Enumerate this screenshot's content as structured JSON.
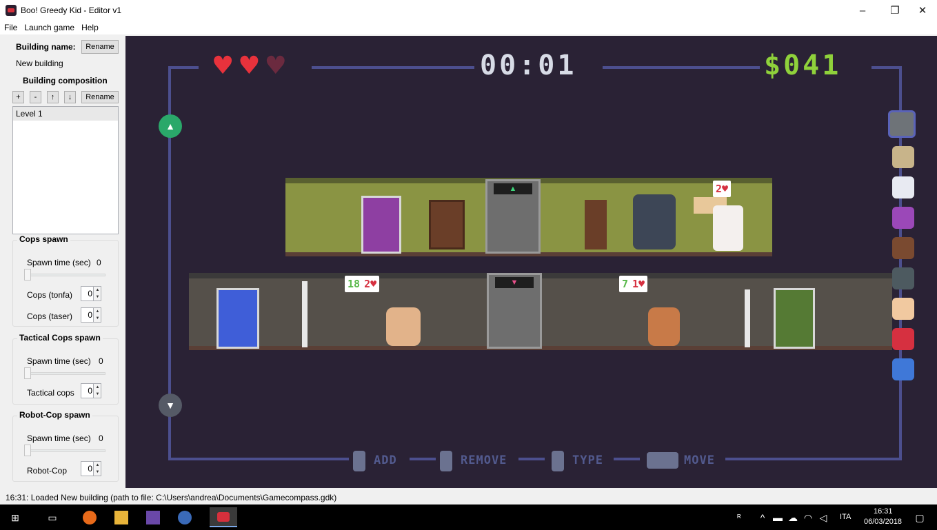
{
  "window": {
    "title": "Boo! Greedy Kid - Editor v1",
    "min_glyph": "–",
    "max_glyph": "❐",
    "close_glyph": "✕"
  },
  "menu": [
    "File",
    "Launch game",
    "Help"
  ],
  "building": {
    "name_label": "Building name:",
    "rename_label": "Rename",
    "name_value": "New building",
    "composition_label": "Building composition",
    "buttons": [
      "+",
      "-",
      "↑",
      "↓"
    ],
    "composition_rename_label": "Rename",
    "levels": [
      "Level 1"
    ]
  },
  "cops_spawn": {
    "title": "Cops spawn",
    "spawn_time_label": "Spawn time (sec)",
    "spawn_time_value": "0",
    "tonfa_label": "Cops (tonfa)",
    "tonfa_value": "0",
    "taser_label": "Cops (taser)",
    "taser_value": "0"
  },
  "tactical_spawn": {
    "title": "Tactical Cops spawn",
    "spawn_time_label": "Spawn time (sec)",
    "spawn_time_value": "0",
    "cops_label": "Tactical cops",
    "cops_value": "0"
  },
  "robocop_spawn": {
    "title": "Robot-Cop spawn",
    "spawn_time_label": "Spawn time (sec)",
    "spawn_time_value": "0",
    "cops_label": "Robot-Cop",
    "cops_value": "0"
  },
  "hud": {
    "hearts": [
      "♥",
      "♥",
      "♥"
    ],
    "heart_colors": [
      "#e8323c",
      "#e8323c",
      "#6b2a3f"
    ],
    "timer": "00:01",
    "money": "$041"
  },
  "bubbles": {
    "nurse": {
      "lives": "2♥"
    },
    "old_man": {
      "count": "18",
      "lives": "2♥"
    },
    "old_lady": {
      "count": "7",
      "lives": "1♥"
    }
  },
  "hints": {
    "add": "ADD",
    "remove": "REMOVE",
    "type": "TYPE",
    "move": "MOVE"
  },
  "status": {
    "message": "16:31: Loaded New building (path to file: C:\\Users\\andrea\\Documents\\Gamecompass.gdk)"
  },
  "taskbar": {
    "lang": "ITA",
    "time": "16:31",
    "date": "06/03/2018"
  },
  "colors": {
    "game_bg": "#2a2235",
    "frame": "#4c4f8e",
    "floor_top": "#8a9443",
    "floor_bottom": "#55504a",
    "money": "#8fd13b"
  }
}
